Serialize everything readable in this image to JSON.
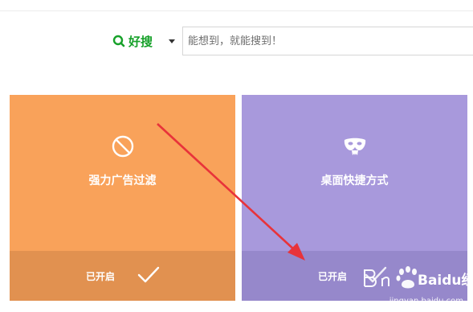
{
  "search": {
    "brand_label": "好搜",
    "placeholder": "能想到，就能搜到！"
  },
  "cards": [
    {
      "title": "强力广告过滤",
      "status": "已开启",
      "icon": "ban-icon",
      "color": "#f9a25a"
    },
    {
      "title": "桌面快捷方式",
      "status": "已开启",
      "icon": "mask-icon",
      "color": "#a899dc"
    }
  ],
  "watermark": {
    "brand": "Baidu经验",
    "url": "jingyan.baidu.com"
  },
  "colors": {
    "brand_green": "#17a12a",
    "annotation_red": "#e8333a"
  }
}
